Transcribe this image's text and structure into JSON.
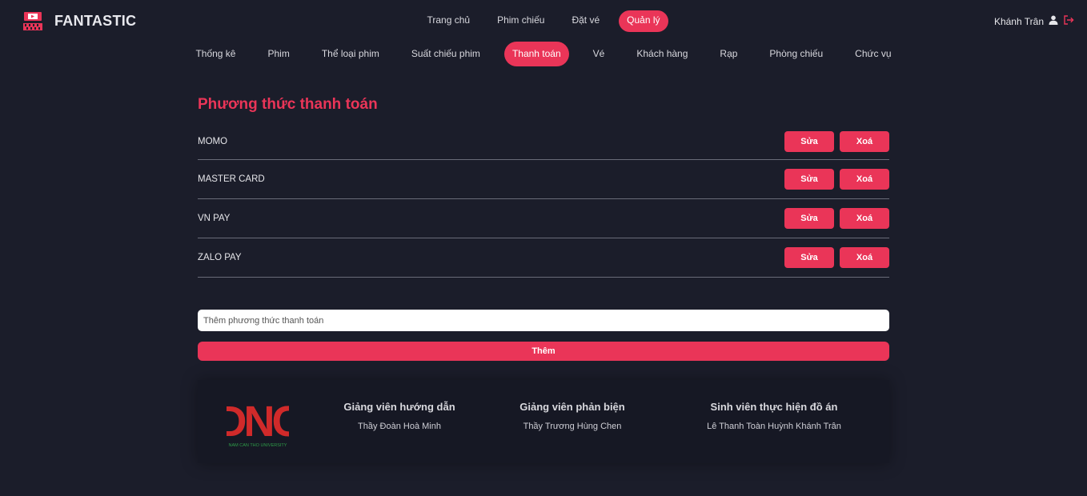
{
  "header": {
    "brand": "FANTASTIC",
    "nav": [
      {
        "label": "Trang chủ"
      },
      {
        "label": "Phim chiếu"
      },
      {
        "label": "Đặt vé"
      },
      {
        "label": "Quản lý",
        "active": true
      }
    ],
    "user_name": "Khánh Trân"
  },
  "subnav": [
    {
      "label": "Thống kê"
    },
    {
      "label": "Phim"
    },
    {
      "label": "Thể loại phim"
    },
    {
      "label": "Suất chiếu phim"
    },
    {
      "label": "Thanh toán",
      "active": true
    },
    {
      "label": "Vé"
    },
    {
      "label": "Khách hàng"
    },
    {
      "label": "Rạp"
    },
    {
      "label": "Phòng chiếu"
    },
    {
      "label": "Chức vụ"
    }
  ],
  "main": {
    "title": "Phương thức thanh toán",
    "edit_label": "Sửa",
    "delete_label": "Xoá",
    "methods": [
      {
        "name": "MOMO"
      },
      {
        "name": "MASTER CARD"
      },
      {
        "name": "VN PAY"
      },
      {
        "name": "ZALO PAY"
      }
    ],
    "add_placeholder": "Thêm phương thức thanh toán",
    "add_button": "Thêm"
  },
  "footer": {
    "logo_text": "DNC",
    "logo_subtext": "NAM CAN THO UNIVERSITY",
    "columns": [
      {
        "heading": "Giảng viên hướng dẫn",
        "value": "Thầy Đoàn Hoà Minh"
      },
      {
        "heading": "Giảng viên phản biện",
        "value": "Thầy Trương Hùng Chen"
      },
      {
        "heading": "Sinh viên thực hiện đồ án",
        "value": "Lê Thanh Toàn Huỳnh Khánh Trân"
      }
    ]
  },
  "colors": {
    "accent": "#ea3558",
    "background": "#1b1d2a",
    "footer": "#161824",
    "logo_red": "#d02a2a",
    "logo_green": "#2e9b48"
  }
}
